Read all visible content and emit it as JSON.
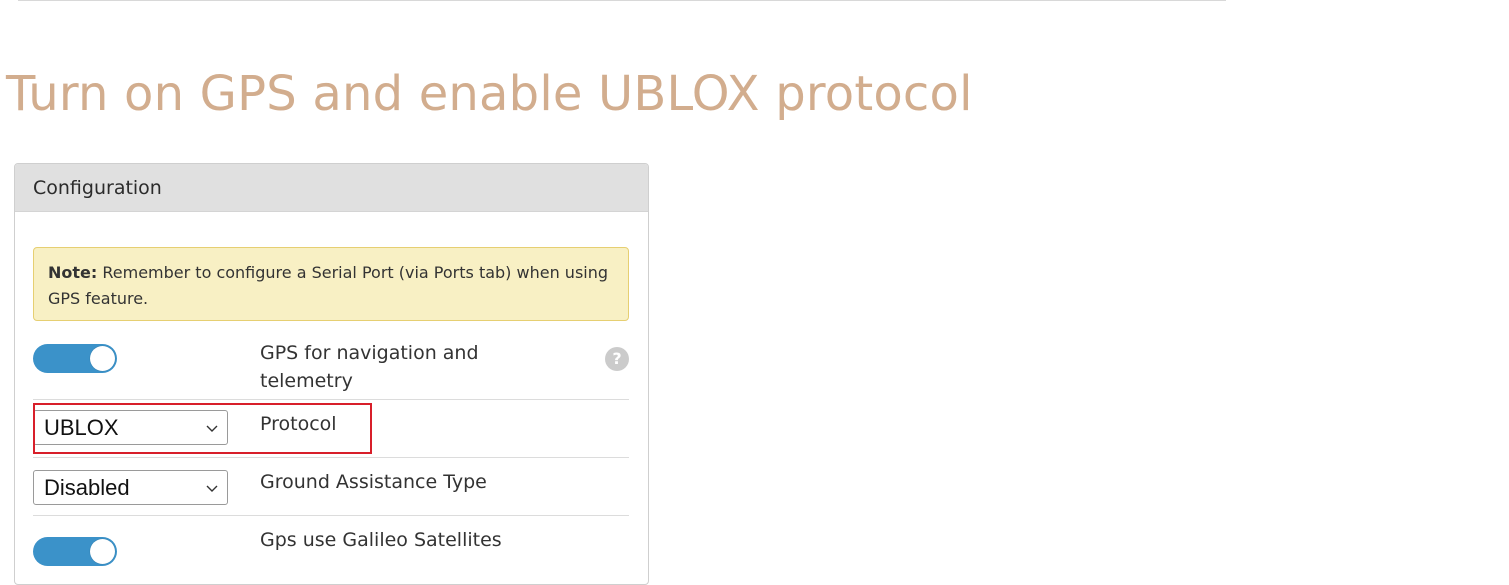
{
  "heading": "Turn on GPS and enable UBLOX protocol",
  "panel": {
    "title": "Configuration",
    "note": {
      "label": "Note:",
      "text": " Remember to configure a Serial Port (via Ports tab) when using GPS feature."
    },
    "gps_toggle": {
      "label": "GPS for navigation and telemetry",
      "enabled": true
    },
    "protocol": {
      "label": "Protocol",
      "value": "UBLOX"
    },
    "ground_assistance": {
      "label": "Ground Assistance Type",
      "value": "Disabled"
    },
    "galileo_toggle": {
      "label": "Gps use Galileo Satellites",
      "enabled": true
    },
    "help_glyph": "?"
  },
  "colors": {
    "heading": "#d2ad8e",
    "toggle_on": "#3b92c9",
    "note_bg": "#f8f0c4",
    "highlight": "#d81f2a"
  }
}
